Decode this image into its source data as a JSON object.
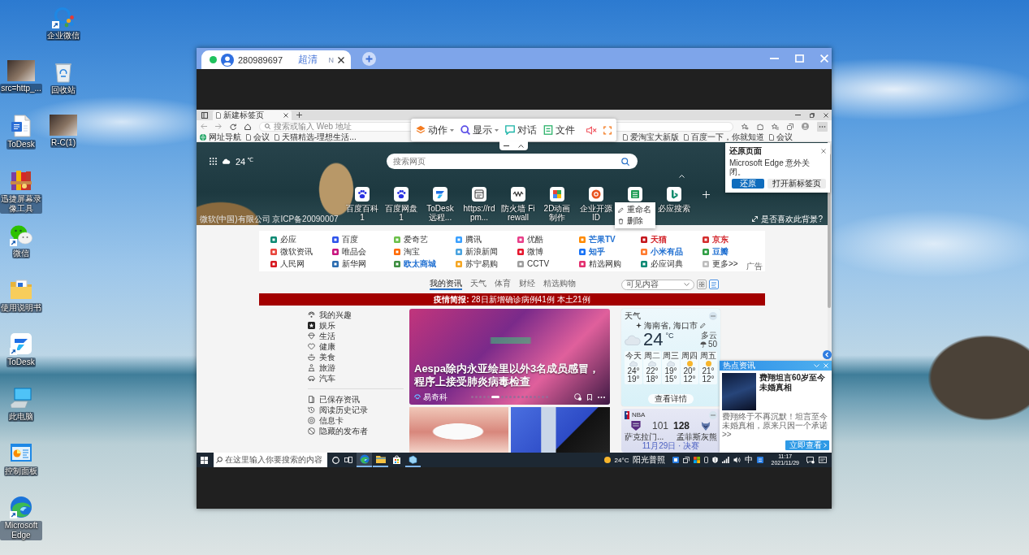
{
  "desktop": {
    "icons": [
      {
        "label": "企业微信",
        "kind": "wecom",
        "shortcut": true
      },
      {
        "label": "src=http_...",
        "kind": "photo",
        "shortcut": false
      },
      {
        "label": "回收站",
        "kind": "recycle-bin",
        "shortcut": false
      },
      {
        "label": "ToDesk",
        "kind": "document",
        "shortcut": false
      },
      {
        "label": "R-C(1)",
        "kind": "photo",
        "shortcut": false
      },
      {
        "label": "迅捷屏幕录像工具",
        "kind": "archive",
        "shortcut": false
      },
      {
        "label": "微信",
        "kind": "wechat",
        "shortcut": true
      },
      {
        "label": "使用说明书",
        "kind": "folder",
        "shortcut": false
      },
      {
        "label": "ToDesk",
        "kind": "todesk",
        "shortcut": true
      },
      {
        "label": "此电脑",
        "kind": "computer",
        "shortcut": false
      },
      {
        "label": "控制面板",
        "kind": "control-panel",
        "shortcut": false
      },
      {
        "label": "Microsoft Edge",
        "kind": "edge",
        "shortcut": true
      }
    ]
  },
  "remote_window": {
    "session": {
      "online": true,
      "device_id": "280989697",
      "quality": "超清",
      "badge": "N"
    },
    "toolbar": {
      "items": [
        {
          "label": "动作",
          "kind": "dropdown"
        },
        {
          "label": "显示",
          "kind": "dropdown"
        },
        {
          "label": "对话",
          "kind": "button"
        },
        {
          "label": "文件",
          "kind": "button"
        }
      ],
      "muted": true
    }
  },
  "browser": {
    "tabs": [
      {
        "title": "新建标签页",
        "selected": true
      }
    ],
    "address_bar": {
      "placeholder": "搜索或输入 Web 地址"
    },
    "favorites": [
      {
        "label": "网址导航",
        "kind": "site"
      },
      {
        "label": "会议",
        "kind": "page"
      },
      {
        "label": "天猫精选-理想生活...",
        "kind": "page"
      },
      {
        "label": "爱淘宝大新版",
        "kind": "page"
      },
      {
        "label": "百度一下，你就知道",
        "kind": "page"
      },
      {
        "label": "会议",
        "kind": "page"
      }
    ],
    "restore_prompt": {
      "title": "还原页面",
      "message": "Microsoft Edge 意外关闭。",
      "buttons": [
        {
          "label": "还原",
          "primary": true
        },
        {
          "label": "打开新标签页",
          "primary": false
        }
      ]
    }
  },
  "new_tab": {
    "weather": {
      "temperature": "24",
      "unit": "℃"
    },
    "search": {
      "placeholder": "搜索网页"
    },
    "quick_links": [
      {
        "label": "百度百科 1",
        "kind": "paw"
      },
      {
        "label": "百度网盘 1",
        "kind": "paw"
      },
      {
        "label": "ToDesk远程...",
        "kind": "todesk"
      },
      {
        "label": "https://rdpm...",
        "kind": "window"
      },
      {
        "label": "防火墙 Firewall",
        "kind": "wave"
      },
      {
        "label": "2D动画制作",
        "kind": "palette"
      },
      {
        "label": "企业开源ID",
        "kind": "ring"
      },
      {
        "kind": "sheet"
      },
      {
        "label": "必应搜索",
        "kind": "bing"
      }
    ],
    "context_menu": [
      {
        "label": "重命名",
        "kind": "rename"
      },
      {
        "label": "删除",
        "kind": "delete"
      }
    ],
    "caption": "微软(中国)有限公司 京ICP备20090007",
    "background_prompt": "是否喜欢此背景?"
  },
  "links": {
    "items": [
      {
        "label": "必应",
        "icon": {
          "color": "#0e8a74"
        }
      },
      {
        "label": "百度",
        "icon": {
          "color": "#2f54eb"
        }
      },
      {
        "label": "爱奇艺",
        "icon": {
          "color": "#6cc04a"
        }
      },
      {
        "label": "腾讯",
        "icon": {
          "color": "#3aa0ff"
        }
      },
      {
        "label": "优酷",
        "icon": {
          "color": "#e8408a"
        }
      },
      {
        "label": "芒果TV",
        "color": "#1f6fd1",
        "icon": {
          "color": "#ff8a00"
        }
      },
      {
        "label": "天猫",
        "color": "#d3262c",
        "icon": {
          "color": "#c4161c"
        }
      },
      {
        "label": "京东",
        "color": "#d3262c",
        "icon": {
          "color": "#d42e2e"
        }
      },
      {
        "label": "微软资讯",
        "icon": {
          "color": "#e8453c"
        }
      },
      {
        "label": "唯品会",
        "icon": {
          "color": "#c8157e"
        }
      },
      {
        "label": "淘宝",
        "icon": {
          "color": "#ff6a00"
        }
      },
      {
        "label": "新浪新闻",
        "icon": {
          "color": "#4aa3df"
        }
      },
      {
        "label": "微博",
        "icon": {
          "color": "#e6162d"
        }
      },
      {
        "label": "知乎",
        "color": "#1f6fd1",
        "icon": {
          "color": "#1772f6"
        }
      },
      {
        "label": "小米有品",
        "color": "#1f6fd1",
        "icon": {
          "color": "#ff7a2e"
        }
      },
      {
        "label": "豆瓣",
        "color": "#1f6fd1",
        "icon": {
          "color": "#2f9e44"
        }
      },
      {
        "label": "人民网",
        "icon": {
          "color": "#d71920"
        }
      },
      {
        "label": "新华网",
        "icon": {
          "color": "#2b6cb0"
        }
      },
      {
        "label": "欧太商城",
        "color": "#1f6fd1",
        "icon": {
          "color": "#3e8e41"
        }
      },
      {
        "label": "苏宁易购",
        "icon": {
          "color": "#f5a623"
        }
      },
      {
        "label": "CCTV",
        "icon": {
          "color": "#9e9e9e"
        }
      },
      {
        "label": "精选网购",
        "icon": {
          "color": "#e3306f"
        }
      },
      {
        "label": "必应词典",
        "icon": {
          "color": "#0e8a74"
        }
      },
      {
        "label": "更多>>",
        "icon": {
          "color": "#bdbdbd"
        }
      }
    ],
    "ad_label": "广告"
  },
  "feed": {
    "tabs": [
      {
        "label": "我的资讯",
        "selected": true
      },
      {
        "label": "天气",
        "selected": false
      },
      {
        "label": "体育",
        "selected": false
      },
      {
        "label": "财经",
        "selected": false
      },
      {
        "label": "精选购物",
        "selected": false
      }
    ],
    "filter": {
      "value": "可见内容"
    },
    "layouts": [
      {
        "kind": "grid",
        "selected": false
      },
      {
        "kind": "list",
        "selected": true
      }
    ],
    "banner": "**疫情简报:** 28日新增确诊病例41例 本土21例",
    "sidebar": {
      "sections": [
        [
          {
            "label": "我的兴趣",
            "kind": "interests"
          },
          {
            "label": "娱乐",
            "kind": "entertainment"
          },
          {
            "label": "生活",
            "kind": "life"
          },
          {
            "label": "健康",
            "kind": "health"
          },
          {
            "label": "美食",
            "kind": "food"
          },
          {
            "label": "旅游",
            "kind": "travel"
          },
          {
            "label": "汽车",
            "kind": "auto"
          }
        ],
        [
          {
            "label": "已保存资讯",
            "kind": "saved"
          },
          {
            "label": "阅读历史记录",
            "kind": "history"
          },
          {
            "label": "信息卡",
            "kind": "cards"
          },
          {
            "label": "隐藏的发布者",
            "kind": "hidden"
          }
        ]
      ]
    },
    "headline": {
      "title": "Aespa除内永亚绘里以外3名成员感冒，程序上接受肺炎病毒检查",
      "source": "易奇科",
      "slides": [
        {
          "selected": false
        },
        {
          "selected": false
        },
        {
          "selected": false
        },
        {
          "selected": false
        },
        {
          "selected": false
        },
        {
          "selected": true
        },
        {
          "selected": false
        },
        {
          "selected": false
        },
        {
          "selected": false
        },
        {
          "selected": false
        },
        {
          "selected": false
        },
        {
          "selected": false
        },
        {
          "selected": false
        },
        {
          "selected": false
        },
        {
          "selected": false
        },
        {
          "selected": false
        },
        {
          "selected": false
        },
        {
          "selected": false
        }
      ]
    },
    "weather_card": {
      "title": "天气",
      "location": "海南省, 海口市",
      "temperature": "24",
      "unit": "°C",
      "condition": "多云",
      "precipitation": "50",
      "days": [
        {
          "day": "今天",
          "kind": "cloudy",
          "high": "24°",
          "low": "19°"
        },
        {
          "day": "周二",
          "kind": "cloudy",
          "high": "22°",
          "low": "18°"
        },
        {
          "day": "周三",
          "kind": "cloudy",
          "high": "19°",
          "low": "15°"
        },
        {
          "day": "周四",
          "kind": "sunny",
          "high": "20°",
          "low": "12°"
        },
        {
          "day": "周五",
          "kind": "sunny",
          "high": "21°",
          "low": "12°"
        }
      ],
      "button": "查看详情"
    },
    "nba_card": {
      "league": "NBA",
      "teams": [
        {
          "name": "萨克拉门...",
          "score": "101",
          "winner": false,
          "kind": "shield"
        },
        {
          "name": "孟菲斯灰熊",
          "score": "128",
          "winner": true,
          "kind": "bear"
        }
      ],
      "status": "11月29日 · 决赛"
    }
  },
  "news_popup": {
    "title": "热点资讯",
    "headline": "费翔坦言60岁至今未婚真相",
    "summary": "费翔终于不再沉默！坦言至今未婚真相，原来只因一个承诺>>",
    "button": "立即查看"
  },
  "taskbar": {
    "search": {
      "placeholder": "在这里输入你要搜索的内容"
    },
    "apps": [
      {
        "kind": "edge",
        "selected": true,
        "running": true
      },
      {
        "kind": "explorer",
        "selected": false,
        "running": true
      },
      {
        "kind": "store",
        "selected": false,
        "running": false
      },
      {
        "kind": "app",
        "selected": false,
        "running": true
      }
    ],
    "weather": {
      "temperature": "24°C",
      "condition": "阳光普照"
    },
    "ime": "中",
    "time": "11:17",
    "date": "2021/11/29"
  }
}
